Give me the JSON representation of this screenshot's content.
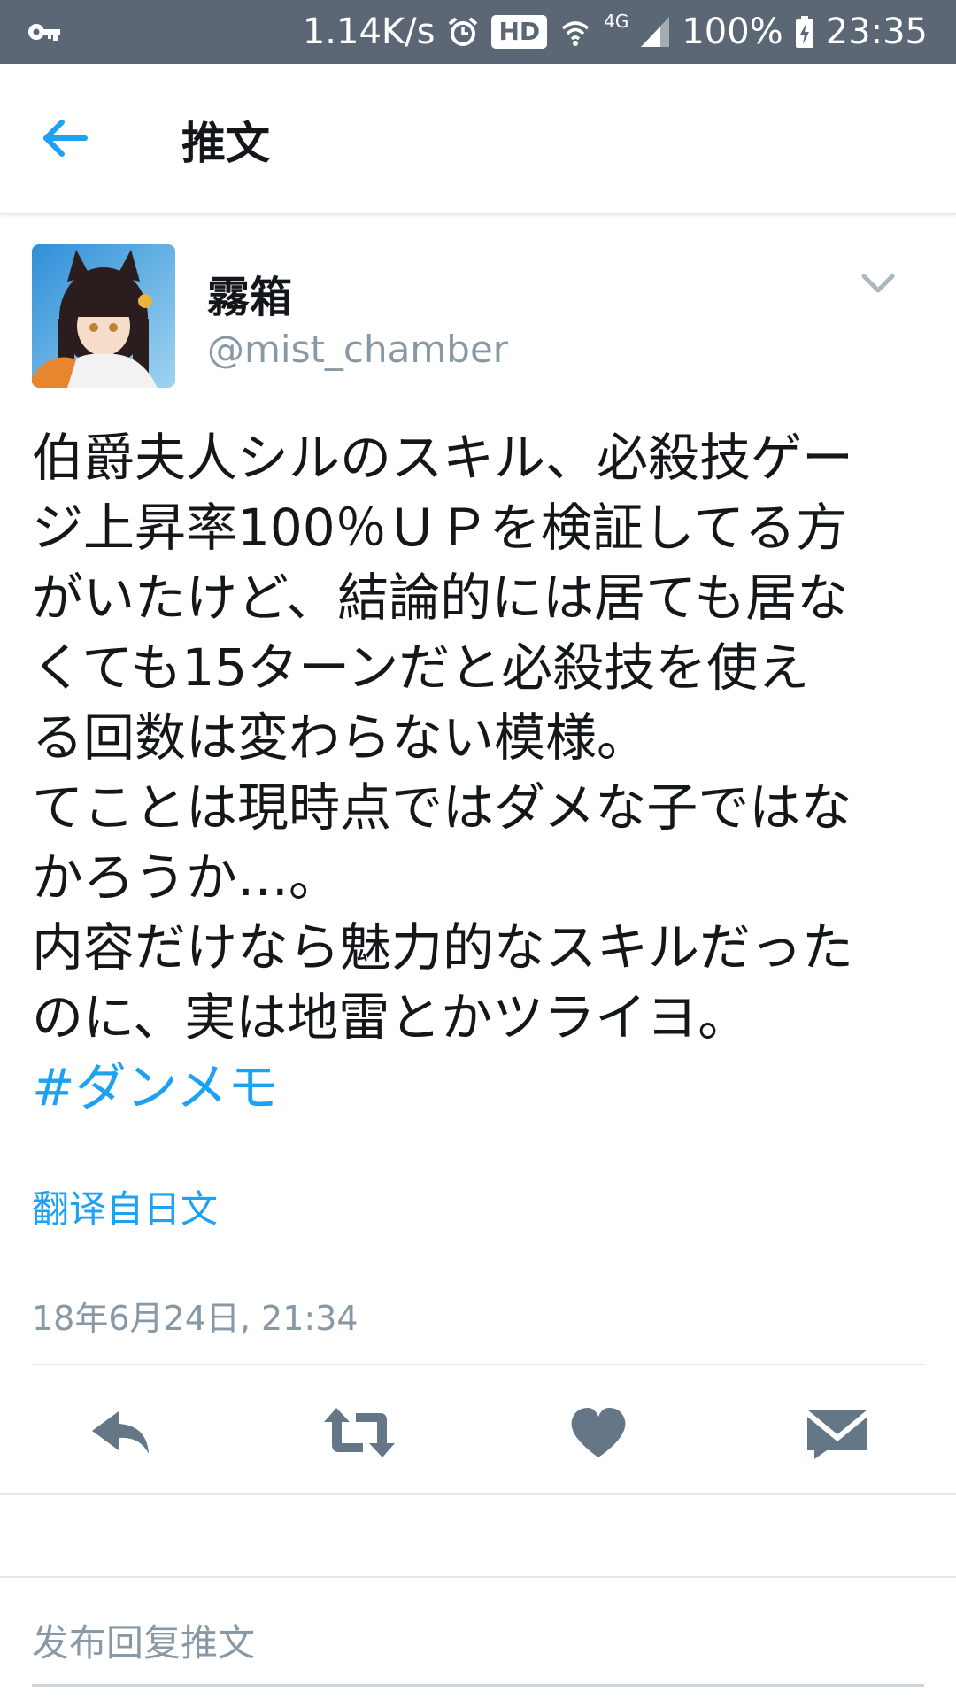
{
  "status_bar": {
    "net_speed": "1.14K/s",
    "hd_badge": "HD",
    "network_type": "4G",
    "battery": "100%",
    "time": "23:35"
  },
  "app_bar": {
    "title": "推文"
  },
  "tweet": {
    "display_name": "霧箱",
    "handle": "@mist_chamber",
    "text_lines": [
      "伯爵夫人シルのスキル、必殺技ゲー",
      "ジ上昇率100％ＵＰを検証してる方",
      "がいたけど、結論的には居ても居な",
      "くても15ターンだと必殺技を使え",
      "る回数は変わらない模様。",
      "てことは現時点ではダメな子ではな",
      "かろうか…。",
      "内容だけなら魅力的なスキルだった",
      "のに、実は地雷とかツライヨ。"
    ],
    "hashtag": "#ダンメモ",
    "translate_label": "翻译自日文",
    "timestamp": "18年6月24日, 21:34"
  },
  "reply_box": {
    "placeholder": "发布回复推文"
  },
  "colors": {
    "status_bar_bg": "#5b6775",
    "accent": "#1da1f2",
    "icon_gray": "#657786",
    "secondary_text": "#8899a6"
  }
}
